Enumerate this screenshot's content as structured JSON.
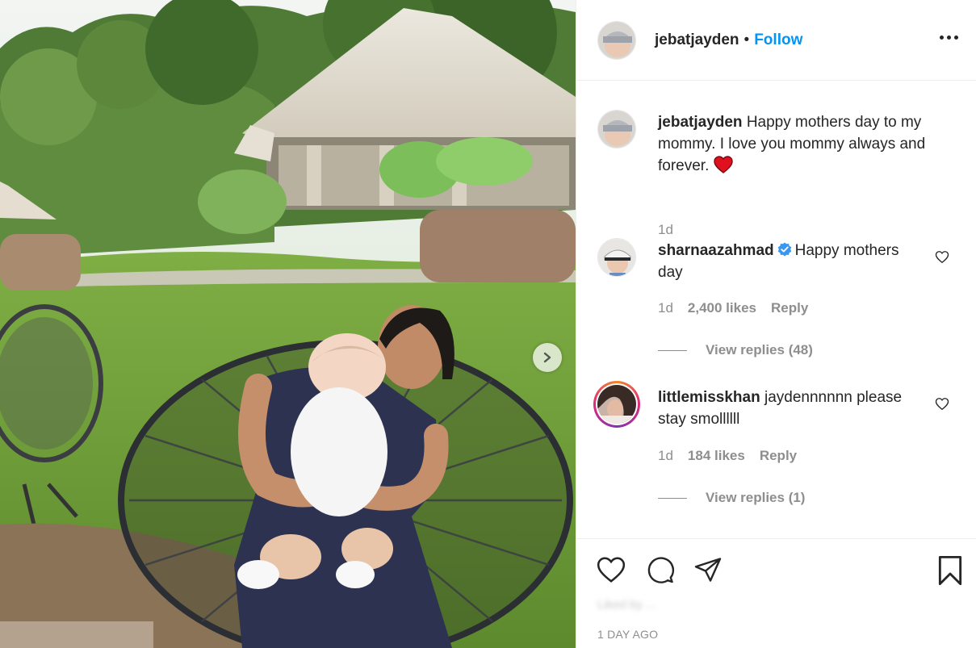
{
  "post": {
    "author": "jebatjayden",
    "separator": "•",
    "follow_label": "Follow",
    "caption": {
      "username": "jebatjayden",
      "text": "Happy mothers day to my mommy. I love you mommy always and forever.",
      "emoji": "❤️",
      "age": "1d"
    },
    "comments": [
      {
        "username": "sharnaazahmad",
        "verified": true,
        "text": "Happy mothers day",
        "age": "1d",
        "likes": "2,400 likes",
        "reply_label": "Reply",
        "view_replies": "View replies (48)"
      },
      {
        "username": "littlemisskhan",
        "verified": false,
        "text": "jaydennnnnn please stay smollllll",
        "age": "1d",
        "likes": "184 likes",
        "reply_label": "Reply",
        "view_replies": "View replies (1)"
      }
    ],
    "liked_by_blurred": "Liked by ...",
    "time_ago": "1 DAY AGO"
  },
  "icons": {
    "more": "more-options-icon",
    "next": "chevron-right-icon",
    "like": "heart-icon",
    "comment": "comment-icon",
    "share": "share-icon",
    "save": "bookmark-icon",
    "verified": "verified-badge-icon"
  },
  "colors": {
    "follow_blue": "#0095f6",
    "verified_blue": "#3897f0",
    "muted_text": "#8e8e8e",
    "primary_text": "#262626",
    "border": "#efefef"
  }
}
